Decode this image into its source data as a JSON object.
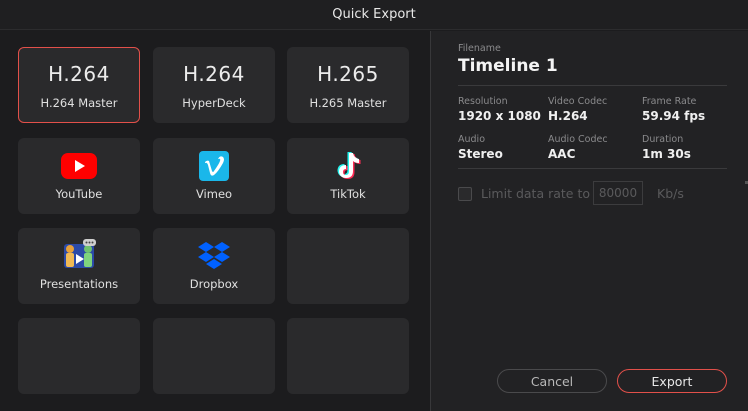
{
  "window": {
    "title": "Quick Export"
  },
  "presets": [
    {
      "big": "H.264",
      "label": "H.264 Master",
      "selected": true
    },
    {
      "big": "H.264",
      "label": "HyperDeck"
    },
    {
      "big": "H.265",
      "label": "H.265 Master"
    },
    {
      "label": "YouTube",
      "icon": "youtube-icon"
    },
    {
      "label": "Vimeo",
      "icon": "vimeo-icon"
    },
    {
      "label": "TikTok",
      "icon": "tiktok-icon"
    },
    {
      "label": "Presentations",
      "icon": "presentations-icon"
    },
    {
      "label": "Dropbox",
      "icon": "dropbox-icon"
    }
  ],
  "details": {
    "filename_label": "Filename",
    "filename": "Timeline 1",
    "resolution_label": "Resolution",
    "resolution": "1920 x 1080",
    "video_codec_label": "Video Codec",
    "video_codec": "H.264",
    "frame_rate_label": "Frame Rate",
    "frame_rate": "59.94 fps",
    "audio_label": "Audio",
    "audio": "Stereo",
    "audio_codec_label": "Audio Codec",
    "audio_codec": "AAC",
    "duration_label": "Duration",
    "duration": "1m 30s"
  },
  "limit": {
    "label": "Limit data rate to",
    "value": "80000",
    "unit": "Kb/s"
  },
  "buttons": {
    "cancel": "Cancel",
    "export": "Export"
  },
  "colors": {
    "accent": "#e2504a",
    "youtube": "#ff0000",
    "vimeo": "#1ab7ea",
    "dropbox": "#0061ff"
  }
}
